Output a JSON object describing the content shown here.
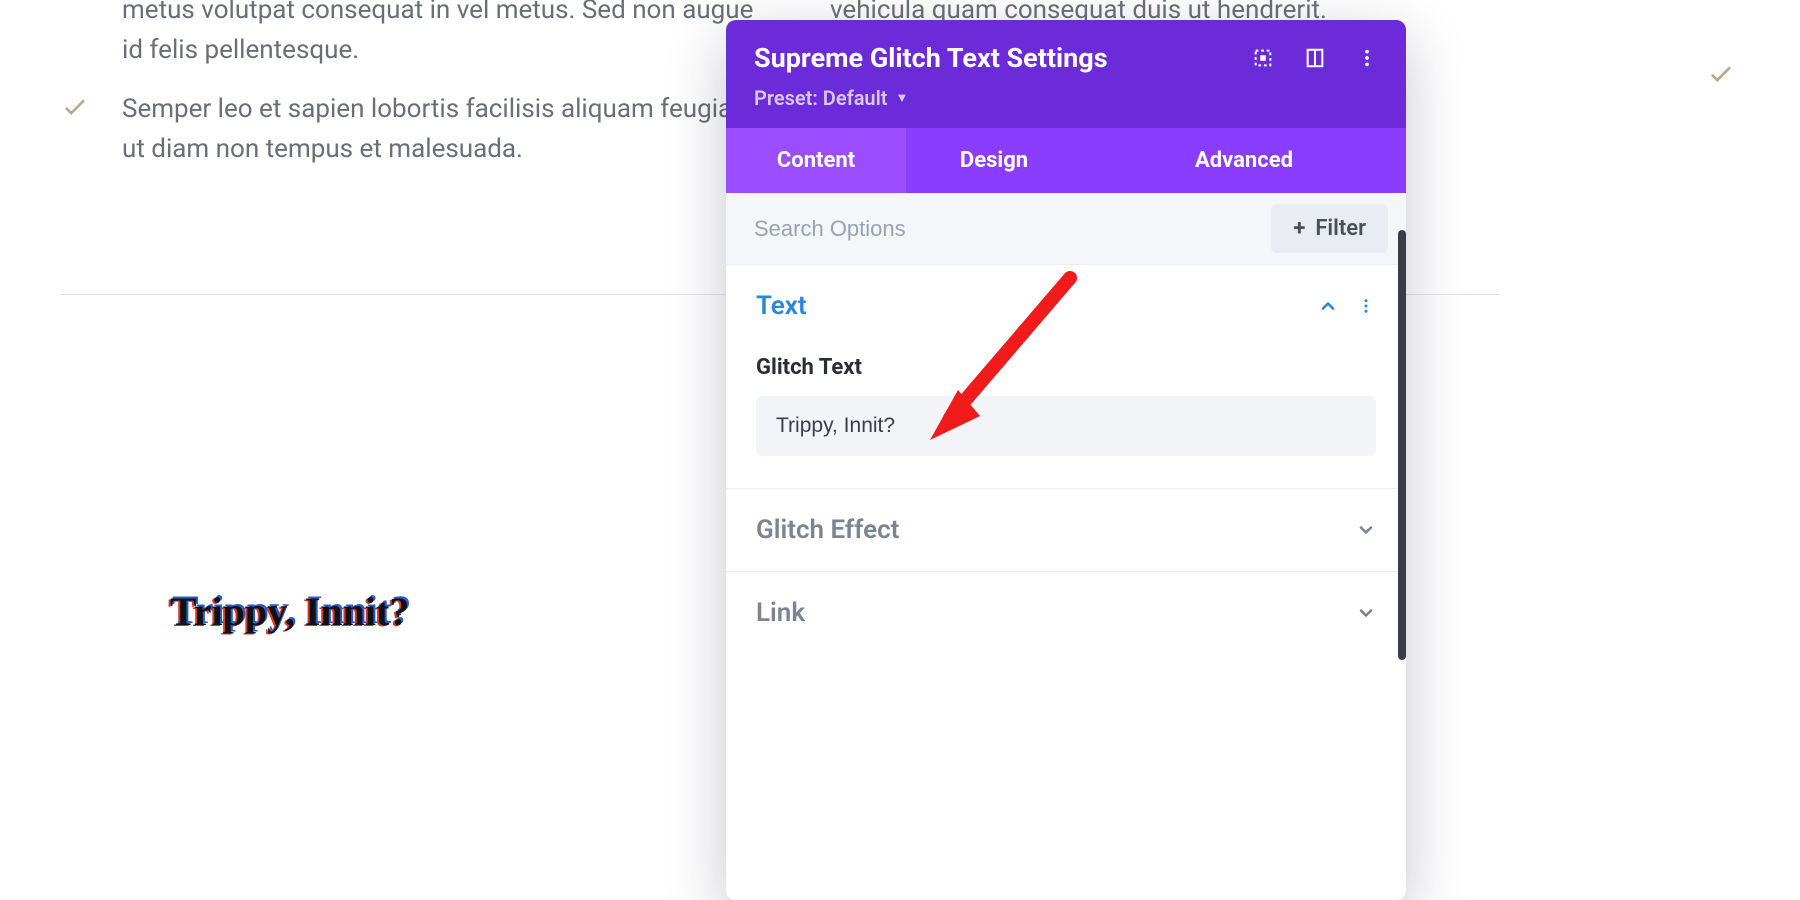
{
  "page": {
    "bullets": [
      "metus volutpat consequat in vel metus. Sed non augue id felis pellentesque.",
      "Semper leo et sapien lobortis facilisis aliquam feugiat ut diam non tempus et malesuada."
    ],
    "right_snippet": "vehicula quam consequat duis ut hendrerit."
  },
  "preview": {
    "text": "Trippy, Innit?"
  },
  "panel": {
    "title": "Supreme Glitch Text Settings",
    "preset_label": "Preset: Default",
    "tabs": {
      "content": "Content",
      "design": "Design",
      "advanced": "Advanced"
    },
    "search": {
      "placeholder": "Search Options"
    },
    "filter": {
      "label": "Filter",
      "plus": "+"
    },
    "sections": {
      "text": {
        "title": "Text",
        "field_label": "Glitch Text",
        "field_value": "Trippy, Innit?"
      },
      "glitch_effect": {
        "title": "Glitch Effect"
      },
      "link": {
        "title": "Link"
      }
    }
  }
}
